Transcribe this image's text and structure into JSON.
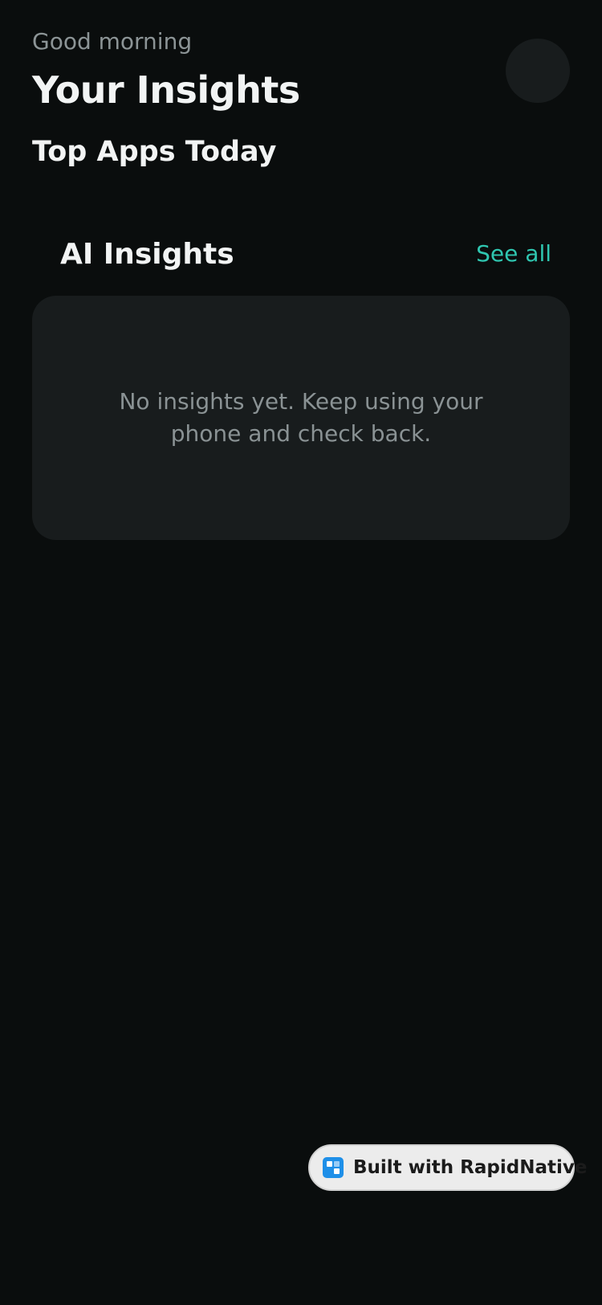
{
  "header": {
    "greeting": "Good morning",
    "title": "Your Insights",
    "avatar_icon": "avatar-placeholder"
  },
  "top_apps": {
    "title": "Top Apps Today"
  },
  "ai_insights": {
    "title": "AI Insights",
    "see_all_label": "See all",
    "empty_message": "No insights yet. Keep using your phone and check back."
  },
  "badge": {
    "label": "Built with RapidNative",
    "icon": "rapidnative-logo-icon"
  },
  "colors": {
    "background": "#0a0d0d",
    "card": "#181c1d",
    "accent": "#2fc6b0",
    "badge_icon": "#1e8fe8"
  }
}
